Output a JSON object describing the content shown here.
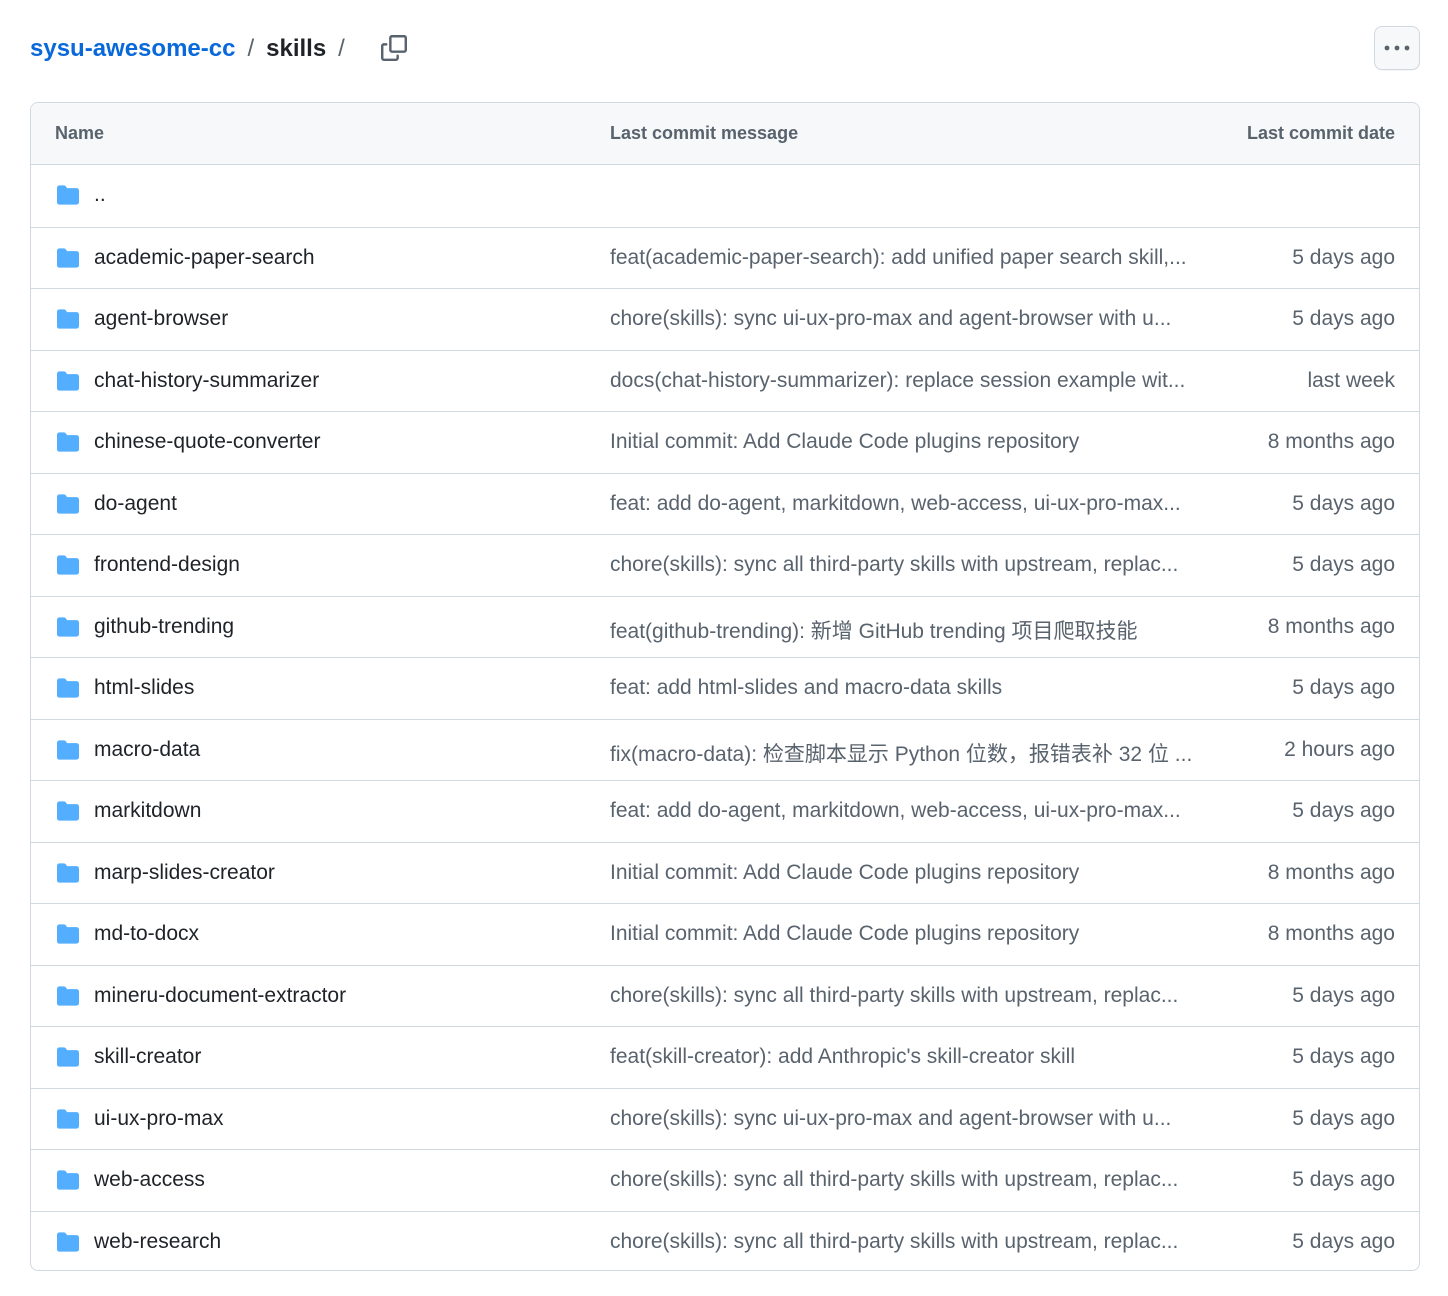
{
  "breadcrumb": {
    "repo": "sysu-awesome-cc",
    "separator": "/",
    "current": "skills",
    "trailing": "/"
  },
  "icons": {
    "copy": "copy-path-icon",
    "more": "kebab-horizontal-icon",
    "folder": "folder-icon"
  },
  "colors": {
    "link": "#0969da",
    "folder": "#54aeff",
    "muted": "#59636e",
    "border": "#d1d9e0",
    "header_bg": "#f6f8fa"
  },
  "table": {
    "columns": [
      "Name",
      "Last commit message",
      "Last commit date"
    ],
    "parent_link": "..",
    "rows": [
      {
        "name": "academic-paper-search",
        "message": "feat(academic-paper-search): add unified paper search skill,...",
        "date": "5 days ago"
      },
      {
        "name": "agent-browser",
        "message": "chore(skills): sync ui-ux-pro-max and agent-browser with u...",
        "date": "5 days ago"
      },
      {
        "name": "chat-history-summarizer",
        "message": "docs(chat-history-summarizer): replace session example wit...",
        "date": "last week"
      },
      {
        "name": "chinese-quote-converter",
        "message": "Initial commit: Add Claude Code plugins repository",
        "date": "8 months ago"
      },
      {
        "name": "do-agent",
        "message": "feat: add do-agent, markitdown, web-access, ui-ux-pro-max...",
        "date": "5 days ago"
      },
      {
        "name": "frontend-design",
        "message": "chore(skills): sync all third-party skills with upstream, replac...",
        "date": "5 days ago"
      },
      {
        "name": "github-trending",
        "message": "feat(github-trending): 新增 GitHub trending 项目爬取技能",
        "date": "8 months ago"
      },
      {
        "name": "html-slides",
        "message": "feat: add html-slides and macro-data skills",
        "date": "5 days ago"
      },
      {
        "name": "macro-data",
        "message": "fix(macro-data): 检查脚本显示 Python 位数，报错表补 32 位 ...",
        "date": "2 hours ago"
      },
      {
        "name": "markitdown",
        "message": "feat: add do-agent, markitdown, web-access, ui-ux-pro-max...",
        "date": "5 days ago"
      },
      {
        "name": "marp-slides-creator",
        "message": "Initial commit: Add Claude Code plugins repository",
        "date": "8 months ago"
      },
      {
        "name": "md-to-docx",
        "message": "Initial commit: Add Claude Code plugins repository",
        "date": "8 months ago"
      },
      {
        "name": "mineru-document-extractor",
        "message": "chore(skills): sync all third-party skills with upstream, replac...",
        "date": "5 days ago"
      },
      {
        "name": "skill-creator",
        "message": "feat(skill-creator): add Anthropic's skill-creator skill",
        "date": "5 days ago"
      },
      {
        "name": "ui-ux-pro-max",
        "message": "chore(skills): sync ui-ux-pro-max and agent-browser with u...",
        "date": "5 days ago"
      },
      {
        "name": "web-access",
        "message": "chore(skills): sync all third-party skills with upstream, replac...",
        "date": "5 days ago"
      },
      {
        "name": "web-research",
        "message": "chore(skills): sync all third-party skills with upstream, replac...",
        "date": "5 days ago"
      }
    ]
  }
}
